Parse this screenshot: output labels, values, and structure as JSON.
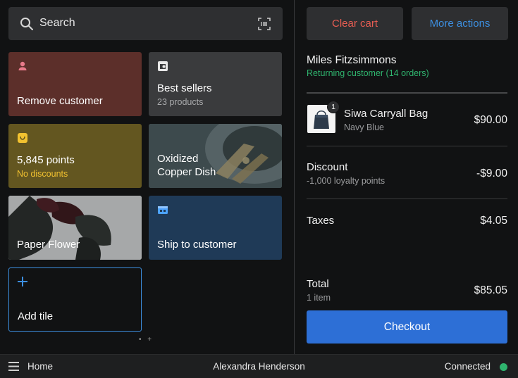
{
  "search": {
    "label": "Search",
    "icon": "search-icon",
    "scan_icon": "barcode-scan-icon"
  },
  "tiles": {
    "remove_customer": {
      "title": "Remove customer",
      "icon": "person-icon",
      "color": "#5c2f2a",
      "icon_color": "#e87a8a"
    },
    "best_sellers": {
      "title": "Best sellers",
      "subtitle": "23 products",
      "icon": "collection-icon",
      "color": "#3a3b3d"
    },
    "points": {
      "title": "5,845 points",
      "subtitle": "No discounts",
      "icon": "loyalty-icon",
      "color": "#635620",
      "icon_color": "#f2c230"
    },
    "copper_dish": {
      "title_line1": "Oxidized",
      "title_line2": "Copper Dish"
    },
    "paper_flower": {
      "title": "Paper Flower"
    },
    "ship_to_customer": {
      "title": "Ship to customer",
      "icon": "shipping-icon",
      "color": "#1f3a57"
    },
    "add_tile": {
      "title": "Add tile",
      "icon": "plus-icon",
      "accent": "#3d8fe0"
    }
  },
  "pager": {
    "text": "• +"
  },
  "cart": {
    "clear_label": "Clear cart",
    "more_label": "More actions",
    "customer_name": "Miles Fitzsimmons",
    "customer_status": "Returning customer (14 orders)",
    "item": {
      "name": "Siwa Carryall Bag",
      "variant": "Navy Blue",
      "price": "$90.00",
      "quantity": "1"
    },
    "discount": {
      "label": "Discount",
      "sub": "-1,000 loyalty points",
      "value": "-$9.00"
    },
    "taxes": {
      "label": "Taxes",
      "value": "$4.05"
    },
    "total": {
      "label": "Total",
      "sub": "1 item",
      "value": "$85.05"
    },
    "checkout_label": "Checkout"
  },
  "bottombar": {
    "home_label": "Home",
    "user": "Alexandra Henderson",
    "connection": "Connected",
    "connection_color": "#2fb46e"
  },
  "colors": {
    "accent_blue": "#2d6fd6",
    "danger_red": "#e85d52",
    "success_green": "#2fb46e",
    "background": "#111213"
  }
}
